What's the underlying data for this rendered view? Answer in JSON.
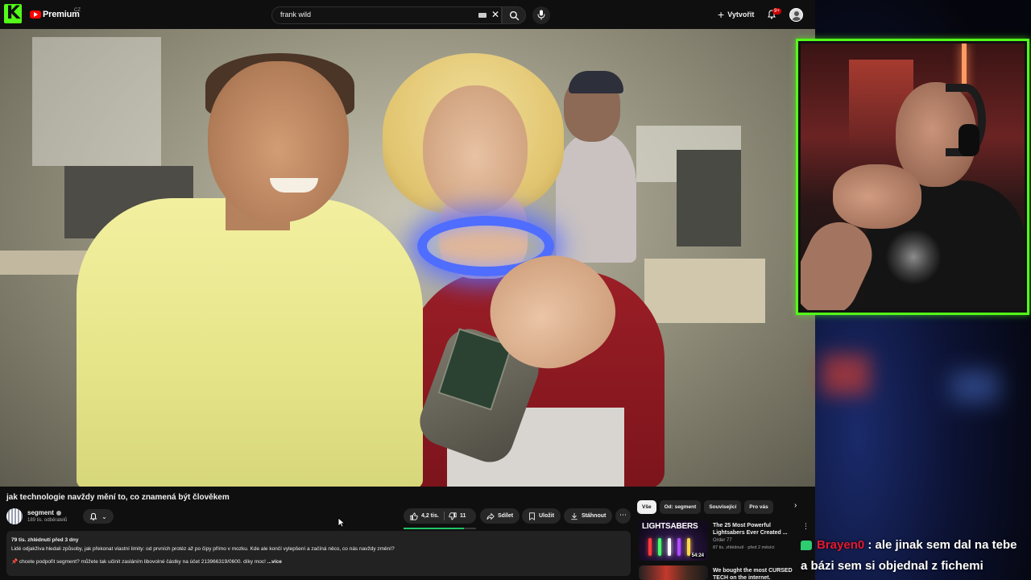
{
  "topbar": {
    "kick_logo": "K",
    "brand": "Premium",
    "country_code": "CZ",
    "search_value": "frank wild",
    "create_label": "Vytvořit",
    "notifications_badge": "9+"
  },
  "video": {
    "title": "jak technologie navždy mění to, co znamená být člověkem",
    "channel_name": "segment",
    "subscribers": "189 tis. odběratelů",
    "likes": "4,2 tis.",
    "dislikes": "11",
    "like_ratio": 0.83,
    "share_label": "Sdílet",
    "save_label": "Uložit",
    "download_label": "Stáhnout",
    "description": {
      "meta": "79 tis. zhlédnutí  před 3 dny",
      "line1": "Lidé odjakživa hledali způsoby, jak překonat vlastní limity: od prvních protéz až po čipy přímo v mozku. Kde ale končí vylepšení a začíná něco, co nás navždy změní?",
      "line2": "📌 chcete podpořit segment? můžete tak učinit zasláním libovolné částky na účet 213966319/0600. díky moc!",
      "more": "...více"
    }
  },
  "recommendations": {
    "chips": [
      "Vše",
      "Od: segment",
      "Související",
      "Pro vás"
    ],
    "items": [
      {
        "thumb_text": "LIGHTSABERS",
        "title": "The 25 Most Powerful Lightsabers Ever Created ...",
        "channel": "Order 77",
        "meta": "87 tis. zhlédnutí · před 2 měsíci",
        "duration": "54:24"
      },
      {
        "title": "We bought the most CURSED TECH on the internet."
      }
    ]
  },
  "chat": {
    "user": "Brayen0",
    "message_part1": " : ale jinak sem dal na tebe",
    "message_part2": "a bázi sem si objednal z fichemi"
  },
  "colors": {
    "kick_green": "#53fc18",
    "youtube_red": "#ff0000",
    "like_bar": "#20c468",
    "chat_username": "#e6192e"
  }
}
